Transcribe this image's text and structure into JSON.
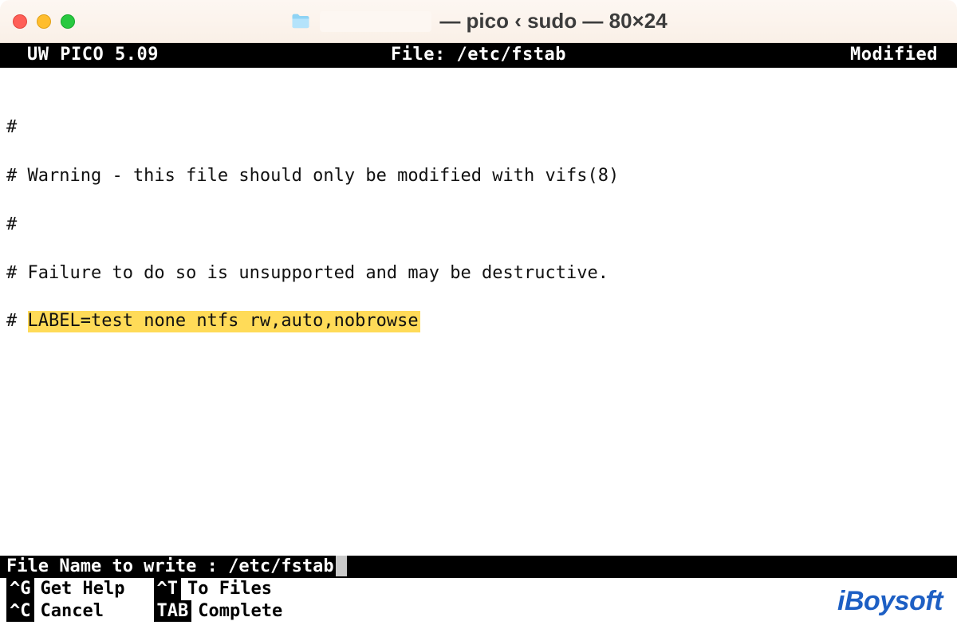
{
  "window": {
    "title_suffix": " — pico ‹ sudo — 80×24"
  },
  "pico": {
    "version_label": "UW PICO 5.09",
    "file_label": "File: /etc/fstab",
    "modified_label": "Modified"
  },
  "lines": {
    "l0": "#",
    "l1": "# Warning - this file should only be modified with vifs(8)",
    "l2": "#",
    "l3": "# Failure to do so is unsupported and may be destructive.",
    "l4_prefix": "# ",
    "l4_highlight": "LABEL=test none ntfs rw,auto,nobrowse"
  },
  "prompt": {
    "label": "File Name to write : /etc/fstab"
  },
  "help": {
    "k1": "^G",
    "d1": "Get Help",
    "k2": "^T",
    "d2": "To Files",
    "k3": "^C",
    "d3": "Cancel",
    "k4": "TAB",
    "d4": "Complete"
  },
  "watermark": "iBoysoft"
}
